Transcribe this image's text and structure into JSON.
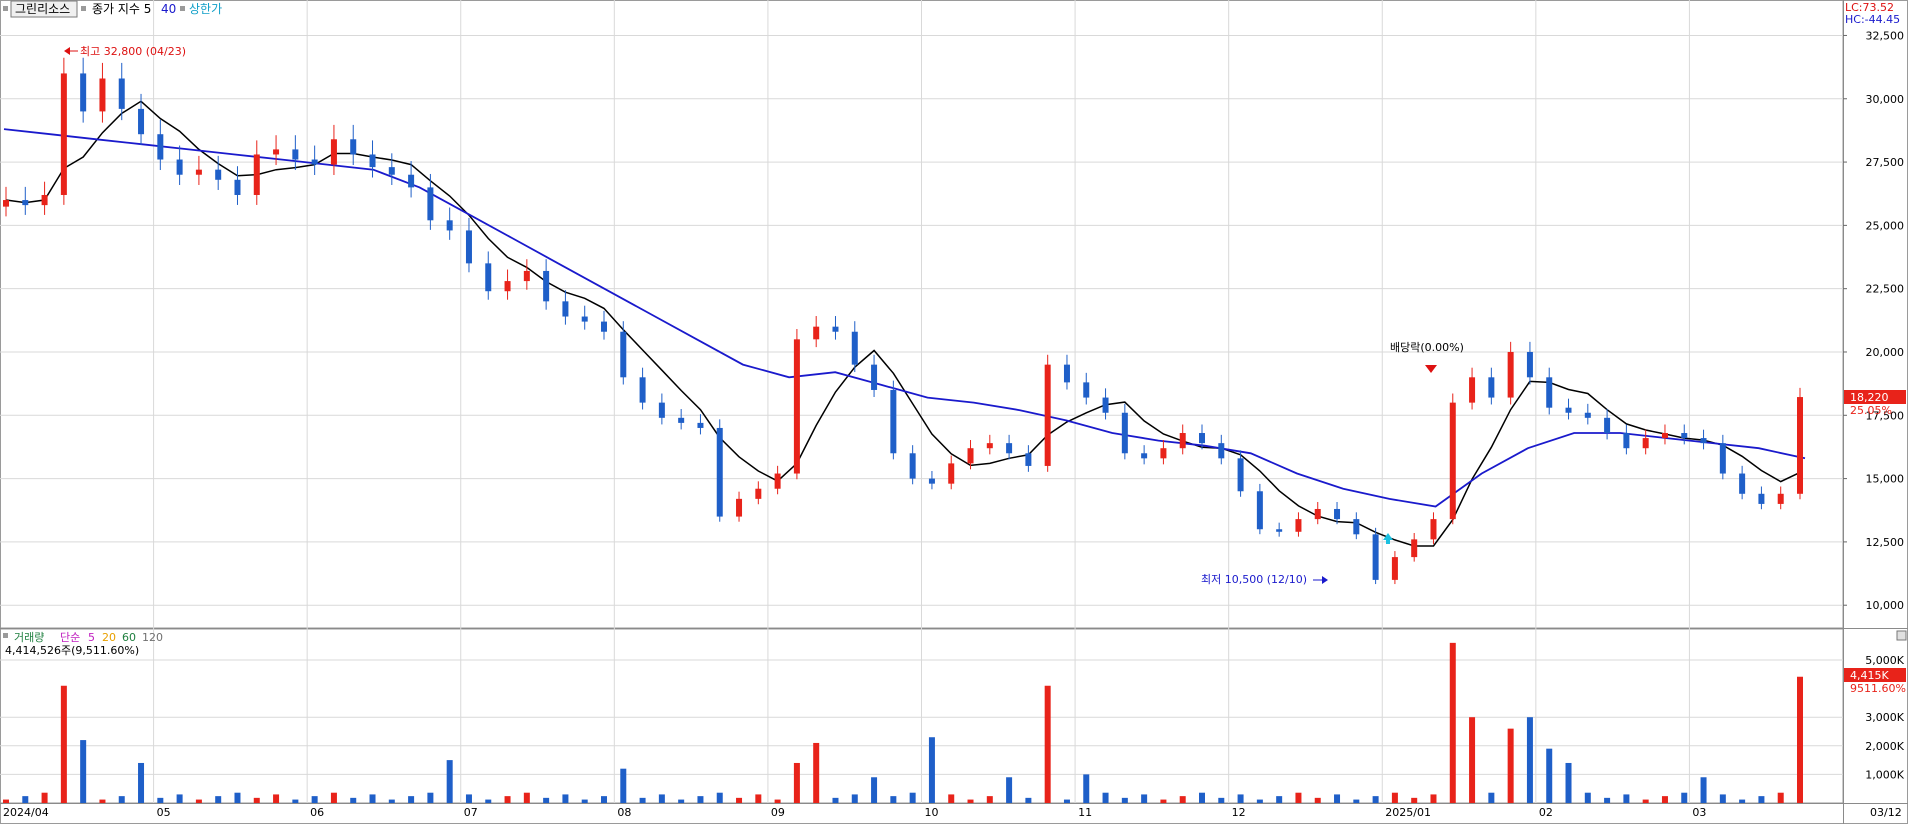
{
  "header": {
    "stock_name": "그린리소스",
    "indicator_label": "종가 지수 5",
    "ma_period": "40",
    "upper_limit_label": "상한가"
  },
  "top_right": {
    "lc": "LC:73.52",
    "hc": "HC:-44.45"
  },
  "price_chart": {
    "y_ticks": [
      "32,500",
      "30,000",
      "27,500",
      "25,000",
      "22,500",
      "20,000",
      "17,500",
      "15,000",
      "12,500",
      "10,000"
    ],
    "y_values": [
      32500,
      30000,
      27500,
      25000,
      22500,
      20000,
      17500,
      15000,
      12500,
      10000
    ],
    "ylim": [
      9100,
      33900
    ],
    "last_price_label": "18,220",
    "last_change_label": "25.05%",
    "high_annotation": "최고 32,800 (04/23)",
    "low_annotation": "최저 10,500 (12/10)",
    "dividend_annotation": "배당락(0.00%)"
  },
  "volume_chart": {
    "legend": {
      "title": "거래량",
      "simple": "단순",
      "p5": "5",
      "p20": "20",
      "p60": "60",
      "p120": "120"
    },
    "summary": "4,414,526주(9,511.60%)",
    "y_ticks": [
      "5,000K",
      "3,000K",
      "2,000K",
      "1,000K"
    ],
    "last_volume_label": "4,415K",
    "last_volume_pct": "9511.60%"
  },
  "x_axis": {
    "labels": [
      "2024/04",
      "05",
      "06",
      "07",
      "08",
      "09",
      "10",
      "11",
      "12",
      "2025/01",
      "02",
      "03",
      "03/12"
    ]
  },
  "colors": {
    "up": "#e8231a",
    "down": "#1f5fc8",
    "ma5": "#000000",
    "ma40": "#1a1acc",
    "grid": "#d9d9d9"
  },
  "chart_data": {
    "type": "candlestick",
    "series": [
      {
        "name": "종가 지수 5",
        "kind": "line",
        "color": "#000000"
      },
      {
        "name": "40",
        "kind": "line",
        "color": "#1a1acc"
      }
    ],
    "price_ohlc_sample": [
      {
        "date": "2024/04/23",
        "high": 32800
      },
      {
        "date": "2024/12/10",
        "low": 10500
      },
      {
        "date": "2025/03/12",
        "close": 18220,
        "change_pct": 25.05
      }
    ],
    "price_path": [
      26000,
      25800,
      26200,
      31000,
      29500,
      30800,
      29600,
      28600,
      27600,
      27000,
      27200,
      26800,
      26200,
      27800,
      28000,
      27600,
      27400,
      28400,
      27800,
      27300,
      27000,
      26500,
      25200,
      24800,
      23500,
      22400,
      22800,
      23200,
      22000,
      21400,
      21200,
      20800,
      19000,
      18000,
      17400,
      17200,
      17000,
      13500,
      14200,
      14600,
      15200,
      20500,
      21000,
      20800,
      19500,
      18500,
      16000,
      15000,
      14800,
      15600,
      16200,
      16400,
      16000,
      15500,
      19500,
      18800,
      18200,
      17600,
      16000,
      15800,
      16200,
      16800,
      16400,
      15800,
      14500,
      13000,
      12900,
      13400,
      13800,
      13400,
      12800,
      11000,
      11900,
      12600,
      13400,
      18000,
      19000,
      18200,
      20000,
      19000,
      17800,
      17600,
      17400,
      16800,
      16200,
      16600,
      16800,
      16600,
      16400,
      15200,
      14400,
      14000,
      14400,
      18220
    ],
    "ma40_path": [
      28800,
      28600,
      28400,
      28200,
      28000,
      27800,
      27600,
      27400,
      27200,
      26500,
      25500,
      24500,
      23500,
      22500,
      21500,
      20500,
      19500,
      19000,
      19200,
      18700,
      18200,
      18000,
      17700,
      17300,
      16800,
      16500,
      16300,
      16000,
      15200,
      14600,
      14200,
      13900,
      15200,
      16200,
      16800,
      16800,
      16600,
      16400,
      16200,
      15800
    ],
    "volume_last_k": 4415
  }
}
